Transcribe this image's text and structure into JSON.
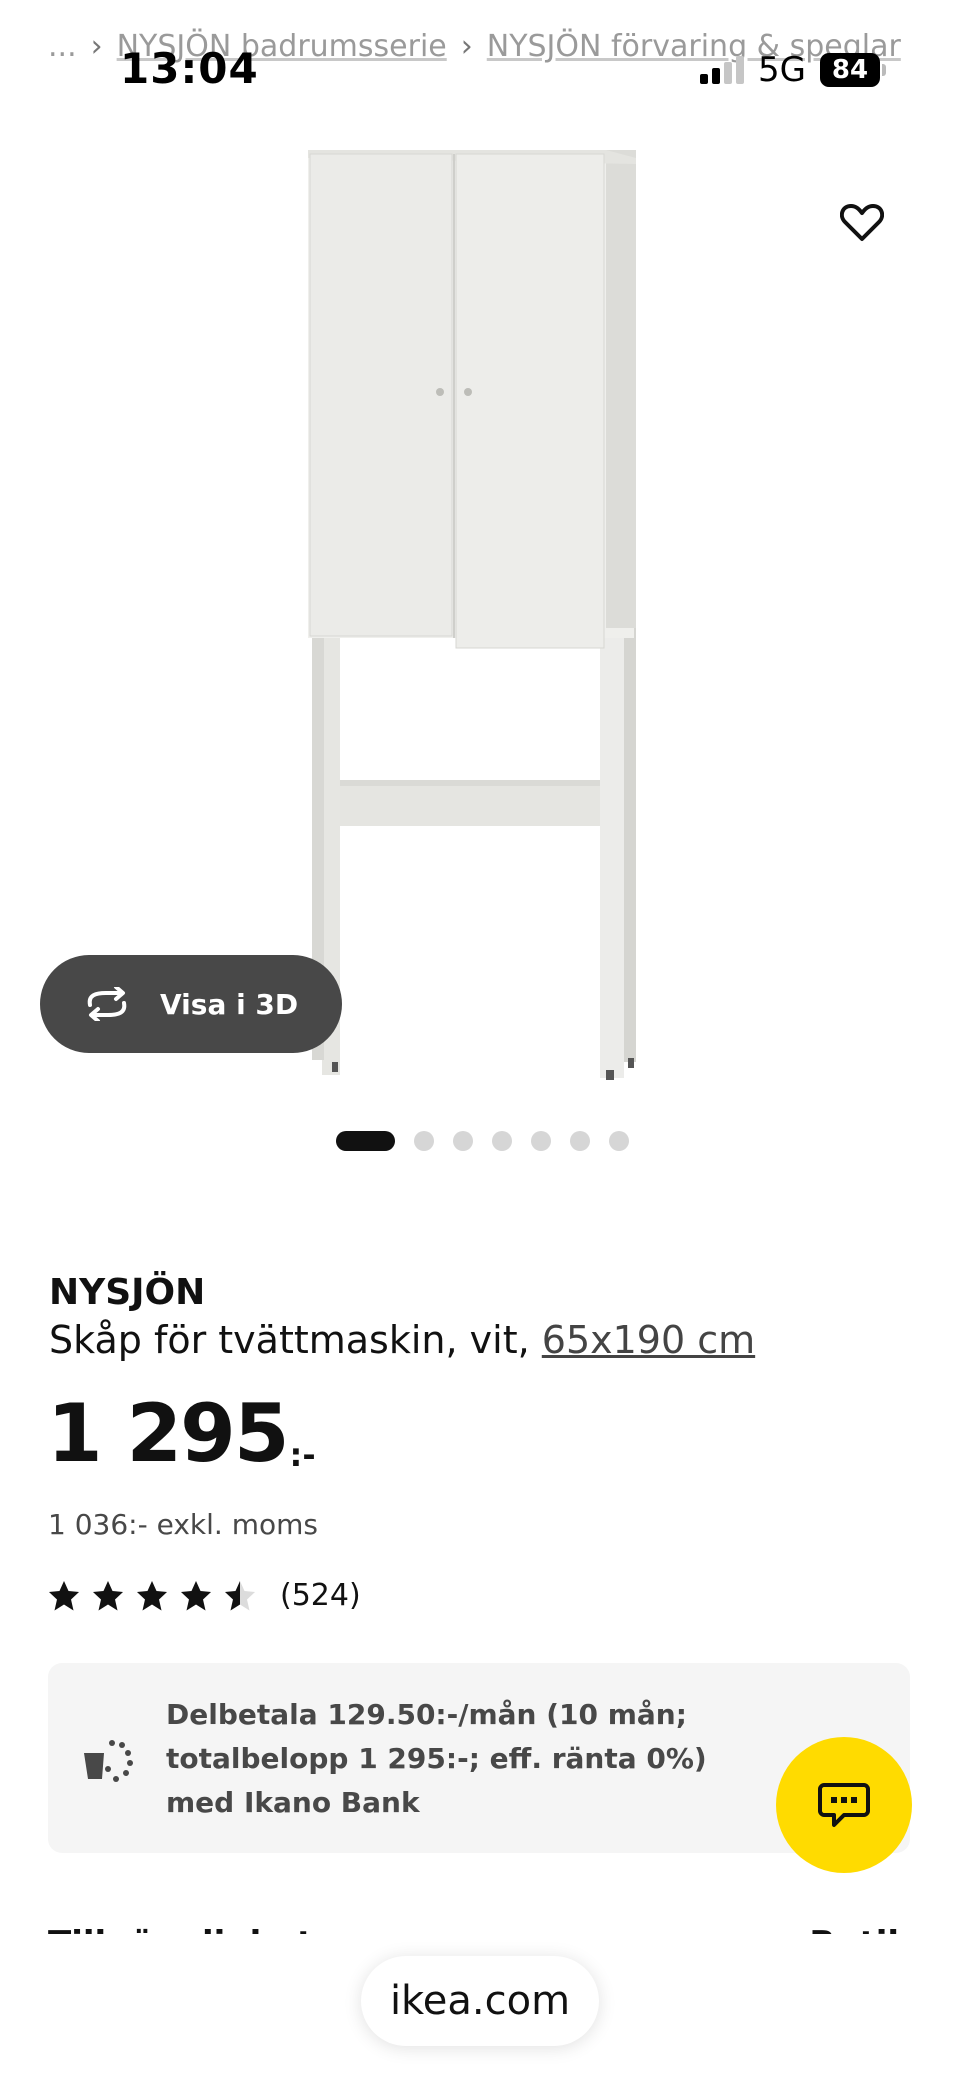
{
  "breadcrumb": {
    "ellipsis": "...",
    "items": [
      "NYSJÖN badrumsserie",
      "NYSJÖN förvaring & speglar"
    ]
  },
  "status_bar": {
    "time": "13:04",
    "network": "5G",
    "battery": "84"
  },
  "gallery": {
    "view_3d_label": "Visa i 3D",
    "image_count": 7,
    "active_index": 0
  },
  "product": {
    "name": "NYSJÖN",
    "description": "Skåp för tvättmaskin, vit,",
    "size_link": "65x190 cm",
    "price": "1 295",
    "price_suffix": ":-",
    "price_excl_vat": "1 036:- exkl. moms",
    "rating_value": 4.5,
    "rating_max": 5,
    "review_count": "(524)"
  },
  "finance": {
    "text": "Delbetala 129.50:-/mån (10 mån; totalbelopp 1 295:-; eff. ränta 0%) med Ikano Bank"
  },
  "cut_off": {
    "left": "Tillgänglighet",
    "right": "Butik"
  },
  "browser": {
    "url": "ikea.com"
  },
  "colors": {
    "accent_yellow": "#ffdb00",
    "view3d_bg": "#484848",
    "finance_bg": "#f5f5f5"
  }
}
